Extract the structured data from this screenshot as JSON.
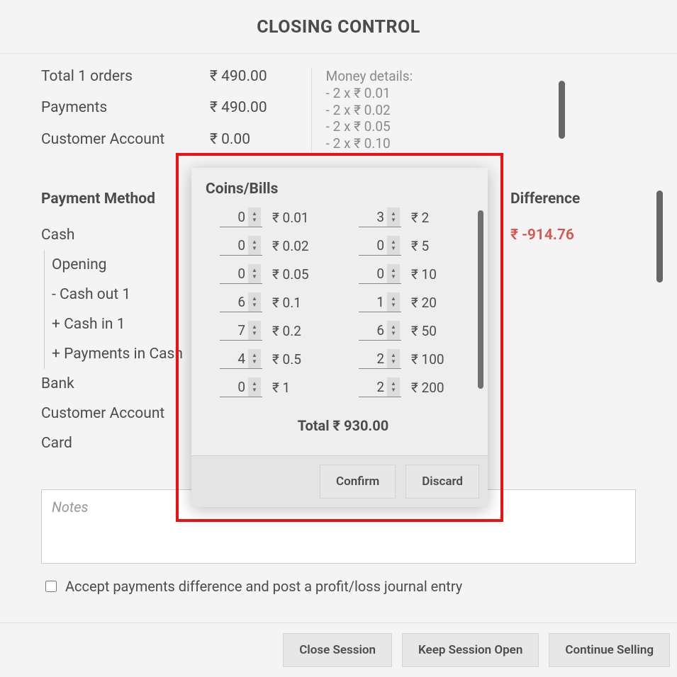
{
  "header": {
    "title": "CLOSING CONTROL"
  },
  "summary": {
    "orders_label": "Total 1 orders",
    "orders_amount": "₹ 490.00",
    "payments_label": "Payments",
    "payments_amount": "₹ 490.00",
    "customer_label": "Customer Account",
    "customer_amount": "₹ 0.00"
  },
  "money_details": {
    "title": "Money details:",
    "lines": [
      "- 2 x ₹ 0.01",
      "- 2 x ₹ 0.02",
      "- 2 x ₹ 0.05",
      "- 2 x ₹ 0.10"
    ]
  },
  "methods": {
    "heading_pm": "Payment Method",
    "heading_diff": "Difference",
    "diff_value": "₹ -914.76",
    "rows": {
      "cash": "Cash",
      "opening": "Opening",
      "cash_out": "-   Cash out 1",
      "cash_in": "+  Cash in 1",
      "payments_cash": "+  Payments in Cash",
      "bank": "Bank",
      "customer_account": "Customer Account",
      "card": "Card"
    }
  },
  "notes": {
    "placeholder": "Notes"
  },
  "accept": {
    "label": "Accept payments difference and post a profit/loss journal entry"
  },
  "footer": {
    "close": "Close Session",
    "keep": "Keep Session Open",
    "continue": "Continue Selling"
  },
  "modal": {
    "title": "Coins/Bills",
    "col1": [
      {
        "qty": "0",
        "denom": "₹ 0.01"
      },
      {
        "qty": "0",
        "denom": "₹ 0.02"
      },
      {
        "qty": "0",
        "denom": "₹ 0.05"
      },
      {
        "qty": "6",
        "denom": "₹ 0.1"
      },
      {
        "qty": "7",
        "denom": "₹ 0.2"
      },
      {
        "qty": "4",
        "denom": "₹ 0.5"
      },
      {
        "qty": "0",
        "denom": "₹ 1"
      }
    ],
    "col2": [
      {
        "qty": "3",
        "denom": "₹ 2"
      },
      {
        "qty": "0",
        "denom": "₹ 5"
      },
      {
        "qty": "0",
        "denom": "₹ 10"
      },
      {
        "qty": "1",
        "denom": "₹ 20"
      },
      {
        "qty": "6",
        "denom": "₹ 50"
      },
      {
        "qty": "2",
        "denom": "₹ 100"
      },
      {
        "qty": "2",
        "denom": "₹ 200"
      }
    ],
    "total_label": "Total ₹ 930.00",
    "confirm": "Confirm",
    "discard": "Discard"
  }
}
